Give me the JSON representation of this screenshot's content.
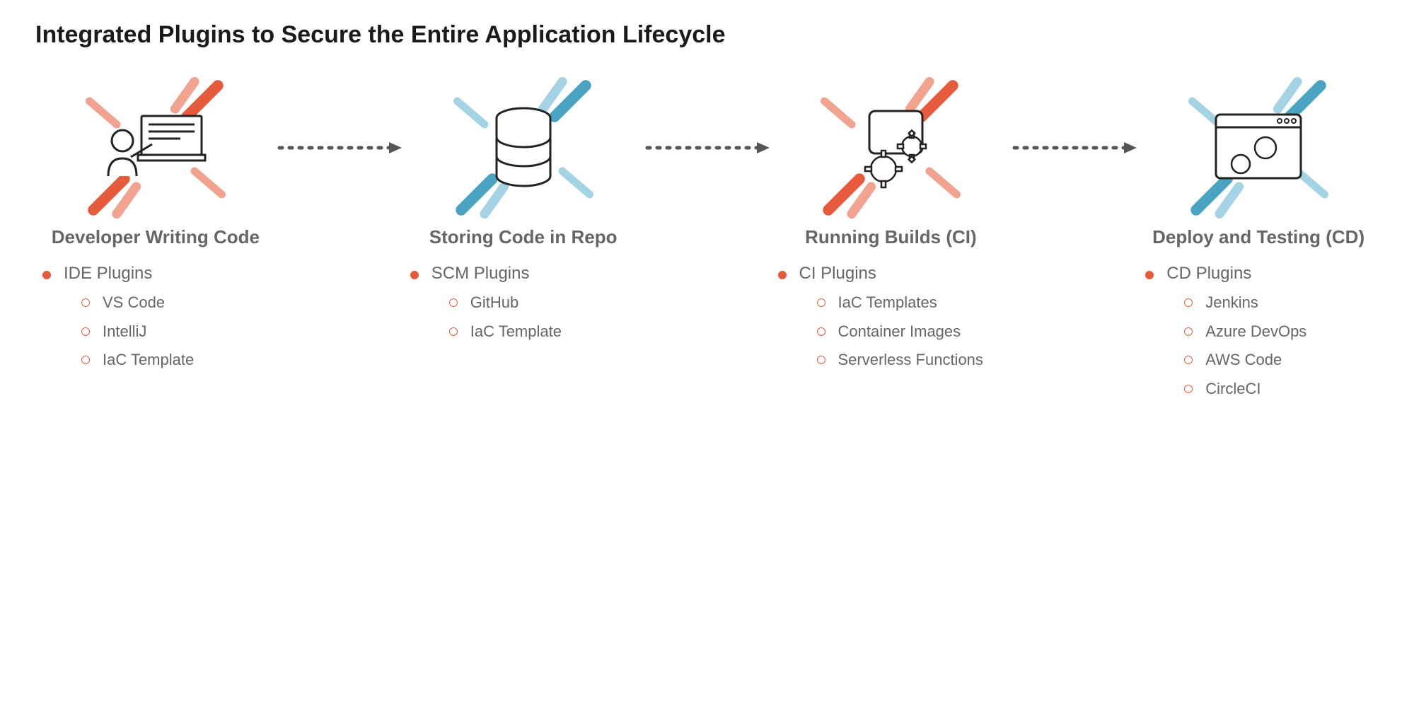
{
  "title": "Integrated Plugins to Secure the Entire Application Lifecycle",
  "stages": [
    {
      "heading": "Developer Writing Code",
      "plugin_label": "IDE Plugins",
      "items": [
        "VS Code",
        "IntelliJ",
        "IaC Template"
      ],
      "burst_color": "orange"
    },
    {
      "heading": "Storing Code in Repo",
      "plugin_label": "SCM Plugins",
      "items": [
        "GitHub",
        "IaC Template"
      ],
      "burst_color": "blue"
    },
    {
      "heading": "Running Builds (CI)",
      "plugin_label": "CI Plugins",
      "items": [
        "IaC Templates",
        "Container Images",
        "Serverless Functions"
      ],
      "burst_color": "orange"
    },
    {
      "heading": "Deploy and Testing (CD)",
      "plugin_label": "CD Plugins",
      "items": [
        "Jenkins",
        "Azure DevOps",
        "AWS Code",
        "CircleCI"
      ],
      "burst_color": "blue"
    }
  ]
}
